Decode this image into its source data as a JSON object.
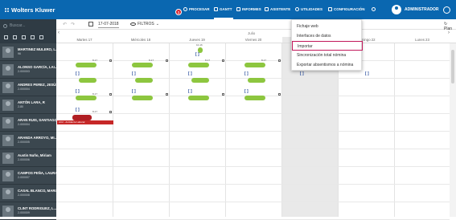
{
  "topbar": {
    "logo": "Wolters Kluwer",
    "nav": [
      {
        "label": "PROCESAR"
      },
      {
        "label": "GANTT"
      },
      {
        "label": "INFORMES"
      },
      {
        "label": "ASISTENTE"
      },
      {
        "label": "UTILIDADES"
      },
      {
        "label": "CONFIGURACIÓN"
      }
    ],
    "badge_count": "1",
    "user": "ADMINISTRADOR",
    "brand_color": "#0a67b0"
  },
  "sidebar": {
    "search_placeholder": "Buscar...",
    "employees": [
      {
        "name": "MARTINEZ MULERO, L...",
        "code": "96"
      },
      {
        "name": "ALONSO GARCÍA, LAI...",
        "code": "2-000003"
      },
      {
        "name": "ANDRES PEREZ, JESÚS...",
        "code": "2-000004"
      },
      {
        "name": "ANTÓN LARA, R",
        "code": "2-80"
      },
      {
        "name": "ARAN RUIS, SANTIAGO",
        "code": "2-000004"
      },
      {
        "name": "ARANDA ARROYO, MI...",
        "code": "2-000005"
      },
      {
        "name": "Austin Nuño, Miriam",
        "code": "2-000006"
      },
      {
        "name": "CAMPOS PEÑA, LAURA...",
        "code": "2-000007"
      },
      {
        "name": "CASAL BLANCO, MARI...",
        "code": "2-000008"
      },
      {
        "name": "CLINT RODRIGUEZ, L...",
        "code": "2-000009"
      }
    ]
  },
  "toolbar": {
    "date": "17-07-2018",
    "filters": "FILTROS",
    "plan": "Plan"
  },
  "calendar": {
    "month": "Julio",
    "days": [
      "Martes 17",
      "Miércoles 18",
      "Jueves 19",
      "Viernes 20",
      "Sábado 21",
      "Domingo 22",
      "Lunes 23"
    ],
    "time_label": "8-17",
    "time_label_alt": "10-16",
    "absence_label": "AC2 - Accidente Laboral"
  },
  "dropdown": {
    "items": [
      "Fichaje web",
      "Interfaces de datos",
      "Importar",
      "Sincronización total nómina",
      "Exportar absentismos a nómina"
    ],
    "highlighted": "Importar",
    "highlight_color": "#c2185b"
  },
  "colors": {
    "shift": "#8dc63f",
    "absence": "#c62828",
    "sidebar": "#3b474f"
  }
}
